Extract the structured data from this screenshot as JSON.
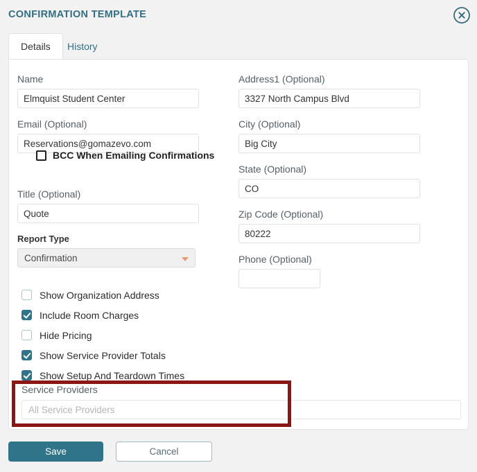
{
  "header": {
    "title": "CONFIRMATION TEMPLATE",
    "close_icon": "close-circle-icon"
  },
  "tabs": [
    {
      "label": "Details",
      "active": true
    },
    {
      "label": "History",
      "active": false
    }
  ],
  "form": {
    "left_column": {
      "name": {
        "label": "Name",
        "value": "Elmquist Student Center"
      },
      "email": {
        "label": "Email (Optional)",
        "value": "Reservations@gomazevo.com"
      },
      "bcc": {
        "label": "BCC When Emailing Confirmations",
        "checked": false
      },
      "title": {
        "label": "Title (Optional)",
        "value": "Quote"
      },
      "report_type": {
        "label": "Report Type",
        "value": "Confirmation",
        "arrow_icon": "chevron-down-icon"
      }
    },
    "right_column": {
      "address1": {
        "label": "Address1 (Optional)",
        "value": "3327 North Campus Blvd"
      },
      "city": {
        "label": "City (Optional)",
        "value": "Big City"
      },
      "state": {
        "label": "State (Optional)",
        "value": "CO"
      },
      "zip": {
        "label": "Zip Code (Optional)",
        "value": "80222"
      },
      "phone": {
        "label": "Phone (Optional)",
        "value": ""
      }
    },
    "options": [
      {
        "label": "Show Organization Address",
        "checked": false
      },
      {
        "label": "Include Room Charges",
        "checked": true
      },
      {
        "label": "Hide Pricing",
        "checked": false
      },
      {
        "label": "Show Service Provider Totals",
        "checked": true
      },
      {
        "label": "Show Setup And Teardown Times",
        "checked": true
      }
    ],
    "service_providers": {
      "label": "Service Providers",
      "value": "",
      "placeholder": "All Service Providers"
    }
  },
  "footer": {
    "save_label": "Save",
    "cancel_label": "Cancel"
  },
  "colors": {
    "accent_teal": "#2f7489",
    "title_teal": "#336e85",
    "annotation_red": "#8c1515",
    "dropdown_arrow_orange": "#e89a72",
    "page_background": "#f2f2f2"
  }
}
